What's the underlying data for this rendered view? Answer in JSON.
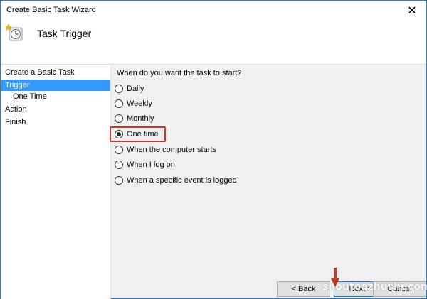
{
  "window": {
    "title": "Create Basic Task Wizard",
    "close_glyph": "✕"
  },
  "header": {
    "title": "Task Trigger",
    "icon": "task-clock-icon"
  },
  "sidebar": {
    "items": [
      {
        "label": "Create a Basic Task",
        "selected": false
      },
      {
        "label": "Trigger",
        "selected": true
      },
      {
        "label": "One Time",
        "selected": false
      },
      {
        "label": "Action",
        "selected": false
      },
      {
        "label": "Finish",
        "selected": false
      }
    ]
  },
  "main": {
    "question": "When do you want the task to start?",
    "options": [
      {
        "label": "Daily",
        "checked": false
      },
      {
        "label": "Weekly",
        "checked": false
      },
      {
        "label": "Monthly",
        "checked": false
      },
      {
        "label": "One time",
        "checked": true
      },
      {
        "label": "When the computer starts",
        "checked": false
      },
      {
        "label": "When I log on",
        "checked": false
      },
      {
        "label": "When a specific event is logged",
        "checked": false
      }
    ]
  },
  "footer": {
    "back_label": "< Back",
    "next_label": "Next >",
    "cancel_label": "Cancel"
  },
  "annotation": {
    "highlight_color": "#c0392b",
    "arrow_color": "#c0392b"
  },
  "watermark": {
    "text": "shoutoazhushi.com"
  },
  "colors": {
    "selection": "#3399ff",
    "window_border": "#2b79c2"
  }
}
